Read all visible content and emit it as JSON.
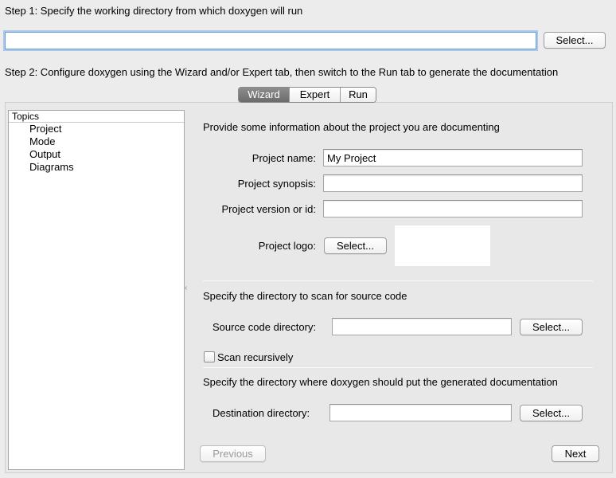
{
  "step1": {
    "label": "Step 1: Specify the working directory from which doxygen will run",
    "input_value": "",
    "select_label": "Select..."
  },
  "step2": {
    "label": "Step 2: Configure doxygen using the Wizard and/or Expert tab, then switch to the Run tab to generate the documentation"
  },
  "tabs": [
    {
      "label": "Wizard",
      "active": true
    },
    {
      "label": "Expert",
      "active": false
    },
    {
      "label": "Run",
      "active": false
    }
  ],
  "topics": {
    "header": "Topics",
    "items": [
      "Project",
      "Mode",
      "Output",
      "Diagrams"
    ]
  },
  "project": {
    "heading": "Provide some information about the project you are documenting",
    "name_label": "Project name:",
    "name_value": "My Project",
    "synopsis_label": "Project synopsis:",
    "synopsis_value": "",
    "version_label": "Project version or id:",
    "version_value": "",
    "logo_label": "Project logo:",
    "logo_select": "Select..."
  },
  "source": {
    "heading": "Specify the directory to scan for source code",
    "dir_label": "Source code directory:",
    "dir_value": "",
    "select_label": "Select...",
    "recursive_label": "Scan recursively",
    "recursive_checked": false
  },
  "destination": {
    "heading": "Specify the directory where doxygen should put the generated documentation",
    "dir_label": "Destination directory:",
    "dir_value": "",
    "select_label": "Select..."
  },
  "nav": {
    "previous": "Previous",
    "next": "Next"
  },
  "splitter_glyph": "‹",
  "colors": {
    "background": "#ececec",
    "focus_ring": "#a9c8ee",
    "active_tab": "#7a7a7a"
  }
}
